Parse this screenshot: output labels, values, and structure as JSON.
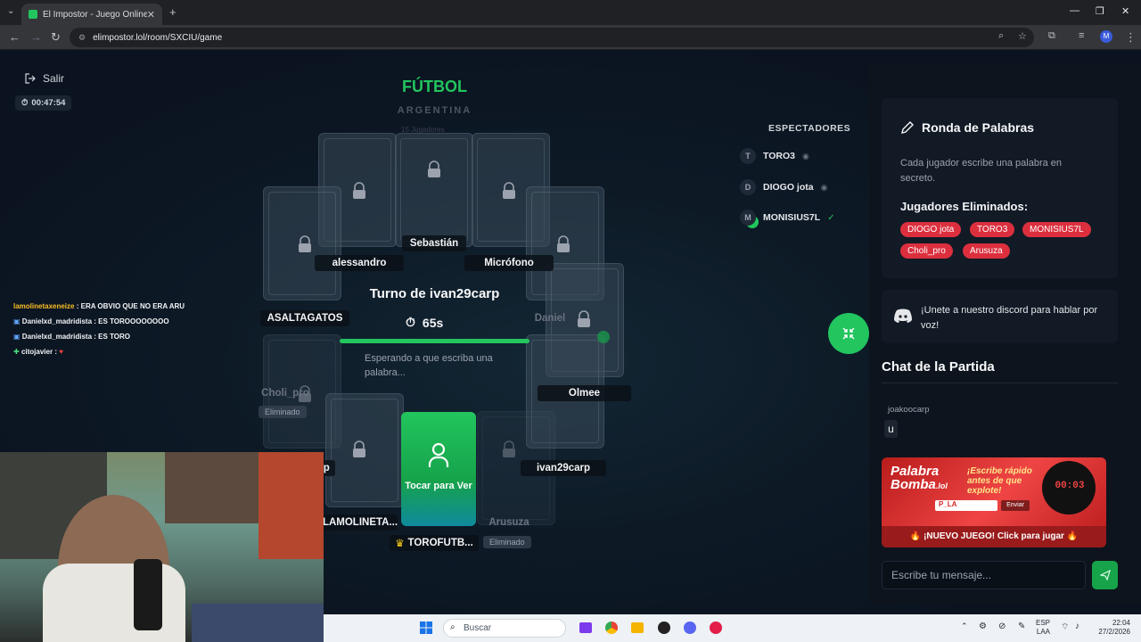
{
  "browser": {
    "tab_title": "El Impostor - Juego Online Gra",
    "tab_close": "✕",
    "new_tab": "+",
    "url": "elimpostor.lol/room/SXCIU/game",
    "profile_initial": "M"
  },
  "header": {
    "exit_label": "Salir",
    "elapsed": "00:47:54",
    "category": "FÚTBOL",
    "subcategory": "ARGENTINA",
    "players_count": "15 Jugadores"
  },
  "players": {
    "sebastian": "Sebastián",
    "alessandro": "alessandro",
    "microfono": "Micrófono",
    "asaltagatos": "ASALTAGATOS",
    "daniel": "Daniel",
    "choli": "Choli_pro",
    "olmee": "Olmee",
    "partial_rp": "rp",
    "ivan": "ivan29carp",
    "lamolineta": "LAMOLINETA...",
    "arusuza": "Arusuza",
    "torofutb": "TOROFUTB...",
    "eliminated": "Eliminado"
  },
  "turn": {
    "title": "Turno de ivan29carp",
    "seconds": "65s",
    "progress": 0.95,
    "waiting": "Esperando a que escriba una palabra..."
  },
  "tap_card": {
    "label": "Tocar para Ver"
  },
  "spectators": {
    "title": "ESPECTADORES",
    "list": [
      {
        "initial": "T",
        "name": "TORO3"
      },
      {
        "initial": "D",
        "name": "DIOGO jota"
      },
      {
        "initial": "M",
        "name": "MONISIUS7L"
      }
    ]
  },
  "stream_chat": [
    {
      "user": "lamolinetaxeneize",
      "msg": ": ERA OBVIO QUE NO ERA ARU"
    },
    {
      "user": "Danielxd_madridista",
      "msg": ": ES TOROOOOOOOO"
    },
    {
      "user": "Danielxd_madridista",
      "msg": ": ES TORO"
    },
    {
      "user": "citojavier",
      "msg": ":"
    }
  ],
  "round_panel": {
    "title": "Ronda de Palabras",
    "description": "Cada jugador escribe una palabra en secreto.",
    "eliminated_title": "Jugadores Eliminados:",
    "eliminated": [
      "DIOGO jota",
      "TORO3",
      "MONISIUS7L",
      "Choli_pro",
      "Arusuza"
    ]
  },
  "discord": {
    "text": "¡Unete a nuestro discord para hablar por voz!"
  },
  "chat": {
    "title": "Chat de la Partida",
    "user": "joakoocarp",
    "message": "u",
    "placeholder": "Escribe tu mensaje..."
  },
  "banner": {
    "logo_line1": "Palabra",
    "logo_line2": "Bomba",
    "logo_suffix": ".lol",
    "tagline": "¡Escribe rápido antes de que explote!",
    "clock": "00:03",
    "input_text": "P_LA",
    "send": "Enviar",
    "footer": "🔥 ¡NUEVO JUEGO! Click para jugar 🔥"
  },
  "taskbar": {
    "search": "Buscar",
    "lang_line1": "ESP",
    "lang_line2": "LAA",
    "time": "22:04",
    "date": "27/2/2026"
  },
  "colors": {
    "accent": "#22c55e",
    "danger": "#dc2f3e",
    "panel": "#111a25"
  }
}
